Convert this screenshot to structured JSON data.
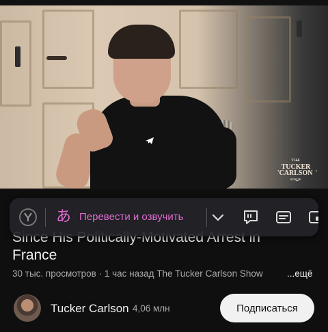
{
  "video": {
    "logo": {
      "the": "THE",
      "line1": "TUCKER",
      "line2": "CARLSON",
      "show": "SHOW"
    }
  },
  "toolbar": {
    "translate_label": "Перевести и озвучить",
    "translate_glyph": "あ"
  },
  "video_info": {
    "title_partial": "Since His Politically-Motivated Arrest in",
    "title_line": "France",
    "meta": "30 тыс. просмотров · 1 час назад  The Tucker Carlson Show",
    "more_label": "...ещё"
  },
  "channel": {
    "name": "Tucker Carlson",
    "subscribers": "4,06 млн",
    "subscribe_label": "Подписаться"
  }
}
